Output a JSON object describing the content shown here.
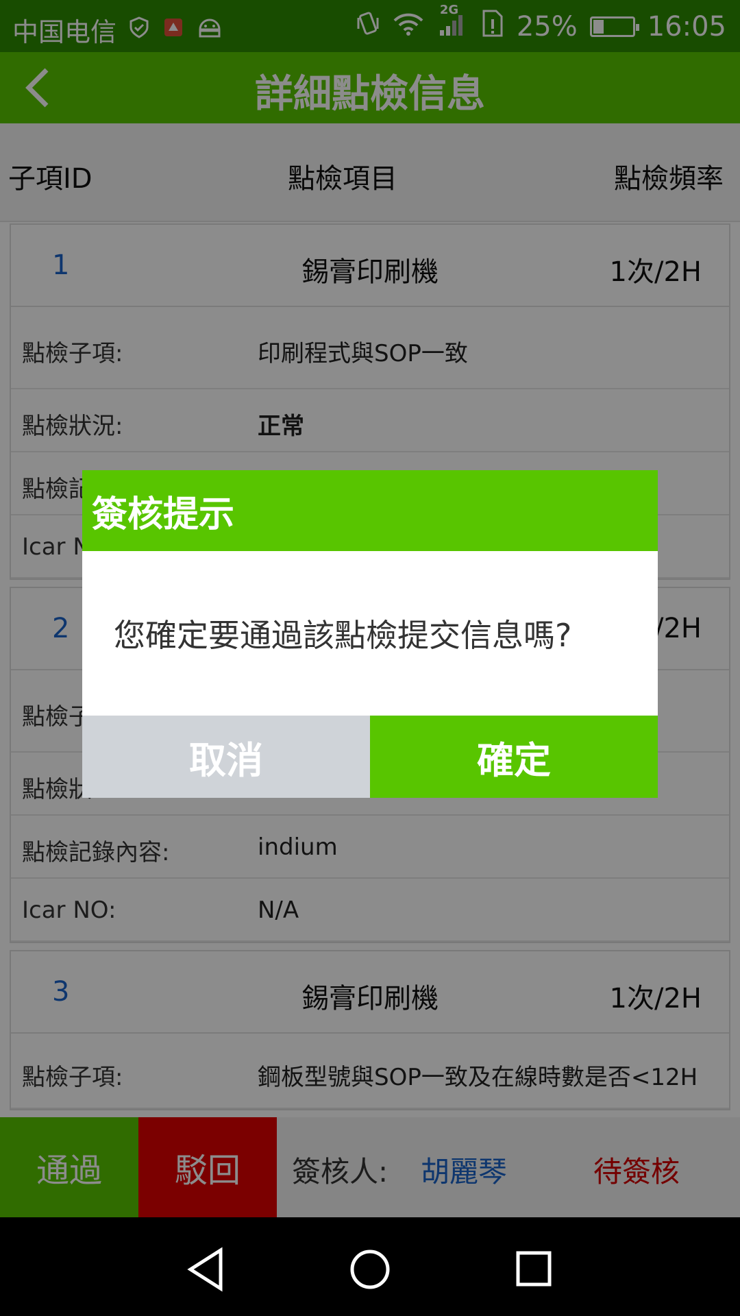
{
  "status_bar": {
    "carrier": "中国电信",
    "network_badge": "2G",
    "battery": "25%",
    "time": "16:05",
    "icons": [
      "shield-icon",
      "notification-icon",
      "android-icon",
      "vibrate-icon",
      "wifi-icon",
      "signal-icon",
      "sim-alert-icon",
      "battery-charging-icon"
    ]
  },
  "app_bar": {
    "title": "詳細點檢信息",
    "back_icon": "chevron-left-icon"
  },
  "table_header": {
    "col_id": "子項ID",
    "col_item": "點檢項目",
    "col_freq": "點檢頻率"
  },
  "cards": [
    {
      "num": "1",
      "name": "錫膏印刷機",
      "freq": "1次/2H",
      "rows": [
        {
          "k": "點檢子項:",
          "v": "印刷程式與SOP一致"
        },
        {
          "k": "點檢狀況:",
          "v": "正常"
        },
        {
          "k": "點檢記",
          "v": ""
        },
        {
          "k": "Icar N",
          "v": ""
        }
      ]
    },
    {
      "num": "2",
      "name": "",
      "freq": "/2H",
      "rows": [
        {
          "k": "點檢子",
          "v": ""
        },
        {
          "k": "點檢狀",
          "v": ""
        },
        {
          "k": "點檢記錄內容:",
          "v": "indium"
        },
        {
          "k": "Icar NO:",
          "v": "N/A"
        }
      ]
    },
    {
      "num": "3",
      "name": "錫膏印刷機",
      "freq": "1次/2H",
      "rows": [
        {
          "k": "點檢子項:",
          "v": "鋼板型號與SOP一致及在線時數是否<12H"
        }
      ]
    }
  ],
  "bottom_bar": {
    "pass_label": "通過",
    "reject_label": "駁回",
    "approver_label": "簽核人:",
    "approver_name": "胡麗琴",
    "status": "待簽核"
  },
  "dialog": {
    "title": "簽核提示",
    "message": "您確定要通過該點檢提交信息嗎?",
    "cancel_label": "取消",
    "ok_label": "確定"
  },
  "nav_bar": {
    "icons": [
      "back-triangle-icon",
      "home-circle-icon",
      "recents-square-icon"
    ]
  },
  "colors": {
    "primary": "#58c500",
    "status_bar": "#2d8a00",
    "reject": "#e00000",
    "link_blue": "#1a63c9",
    "pending_red": "#d40000",
    "dialog_cancel": "#cfd3d8"
  }
}
